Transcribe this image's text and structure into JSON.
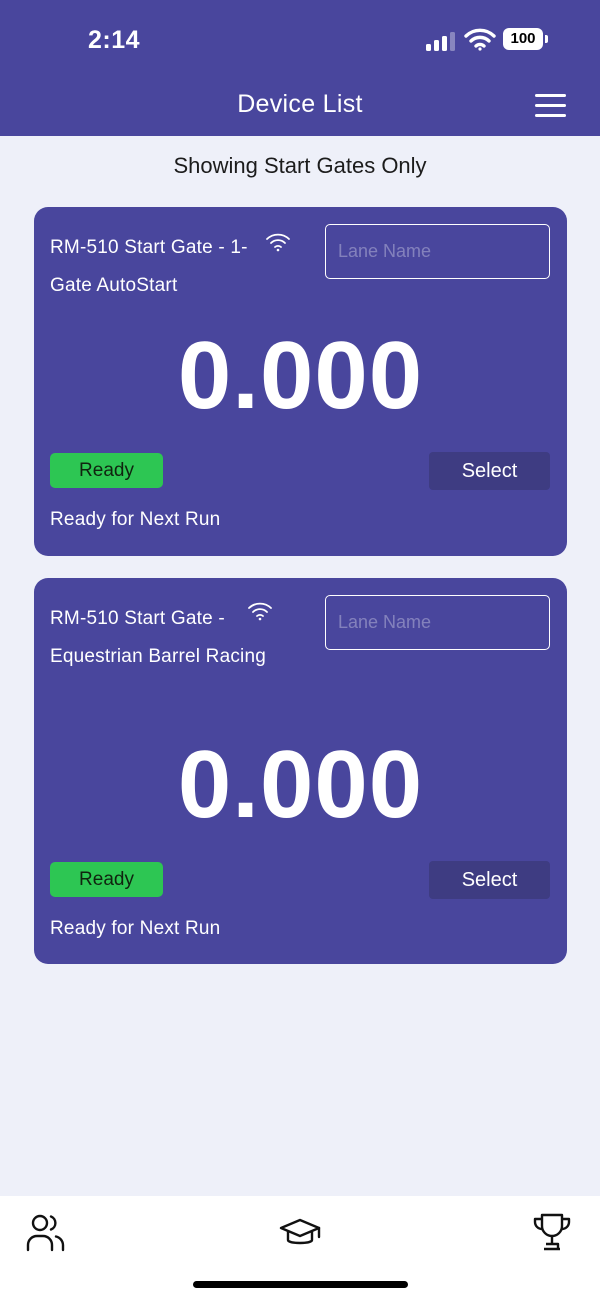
{
  "status_bar": {
    "time": "2:14",
    "battery": "100",
    "signal_bars_active": 3,
    "signal_bars_total": 4
  },
  "header": {
    "title": "Device List",
    "menu_icon": "hamburger-menu-icon"
  },
  "filter_text": "Showing Start Gates Only",
  "devices": [
    {
      "name": "RM-510 Start Gate - 1- Gate AutoStart",
      "lane_placeholder": "Lane Name",
      "lane_value": "",
      "time": "0.000",
      "state": "Ready",
      "select_label": "Select",
      "status": "Ready for Next Run",
      "connection_icon": "wifi-icon"
    },
    {
      "name": "RM-510 Start Gate - Equestrian Barrel Racing",
      "lane_placeholder": "Lane Name",
      "lane_value": "",
      "time": "0.000",
      "state": "Ready",
      "select_label": "Select",
      "status": "Ready for Next Run",
      "connection_icon": "wifi-icon"
    }
  ],
  "tabbar": {
    "tabs": [
      {
        "icon": "users-icon"
      },
      {
        "icon": "graduation-cap-icon"
      },
      {
        "icon": "trophy-icon"
      }
    ]
  },
  "colors": {
    "header_bg": "#49469d",
    "card_bg": "#49469d",
    "page_bg": "#eef0f9",
    "ready_badge": "#2dc653",
    "select_button": "#3e3c82",
    "text_on_dark": "#ffffff"
  }
}
